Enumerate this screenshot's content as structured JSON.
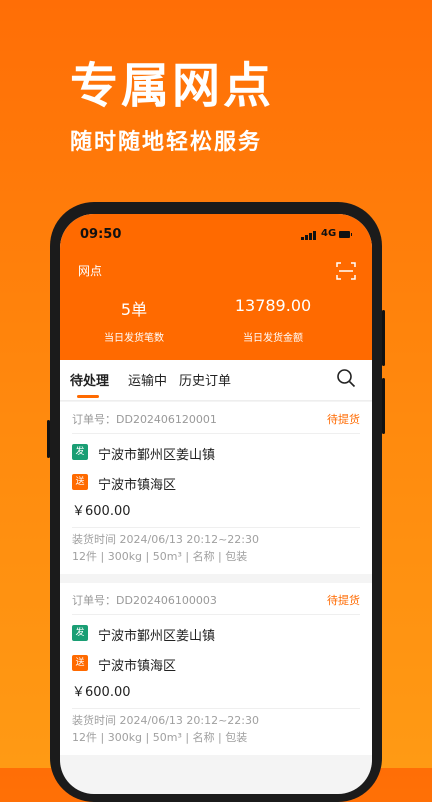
{
  "hero": {
    "title": "专属网点",
    "subtitle": "随时随地轻松服务"
  },
  "status_bar": {
    "time": "09:50",
    "network": "4G"
  },
  "header": {
    "station_label": "网点",
    "stats": [
      {
        "value": "5单",
        "label": "当日发货笔数"
      },
      {
        "value": "13789.00",
        "label": "当日发货金额"
      }
    ]
  },
  "tabs": [
    {
      "label": "待处理",
      "active": true
    },
    {
      "label": "运输中",
      "active": false
    },
    {
      "label": "历史订单",
      "active": false
    }
  ],
  "orders": [
    {
      "order_no": "订单号：DD202406120001",
      "status": "待提货",
      "from_badge": "发",
      "from": "宁波市鄞州区姜山镇",
      "to_badge": "送",
      "to": "宁波市镇海区",
      "price": "￥600.00",
      "load_time": "装货时间   2024/06/13 20:12~22:30",
      "specs": "12件 | 300kg | 50m³ | 名称 | 包装"
    },
    {
      "order_no": "订单号：DD202406100003",
      "status": "待提货",
      "from_badge": "发",
      "from": "宁波市鄞州区姜山镇",
      "to_badge": "送",
      "to": "宁波市镇海区",
      "price": "￥600.00",
      "load_time": "装货时间   2024/06/13 20:12~22:30",
      "specs": "12件 | 300kg | 50m³ | 名称 | 包装"
    }
  ],
  "colors": {
    "accent": "#ff6a00",
    "from_badge": "#1a9e74"
  }
}
